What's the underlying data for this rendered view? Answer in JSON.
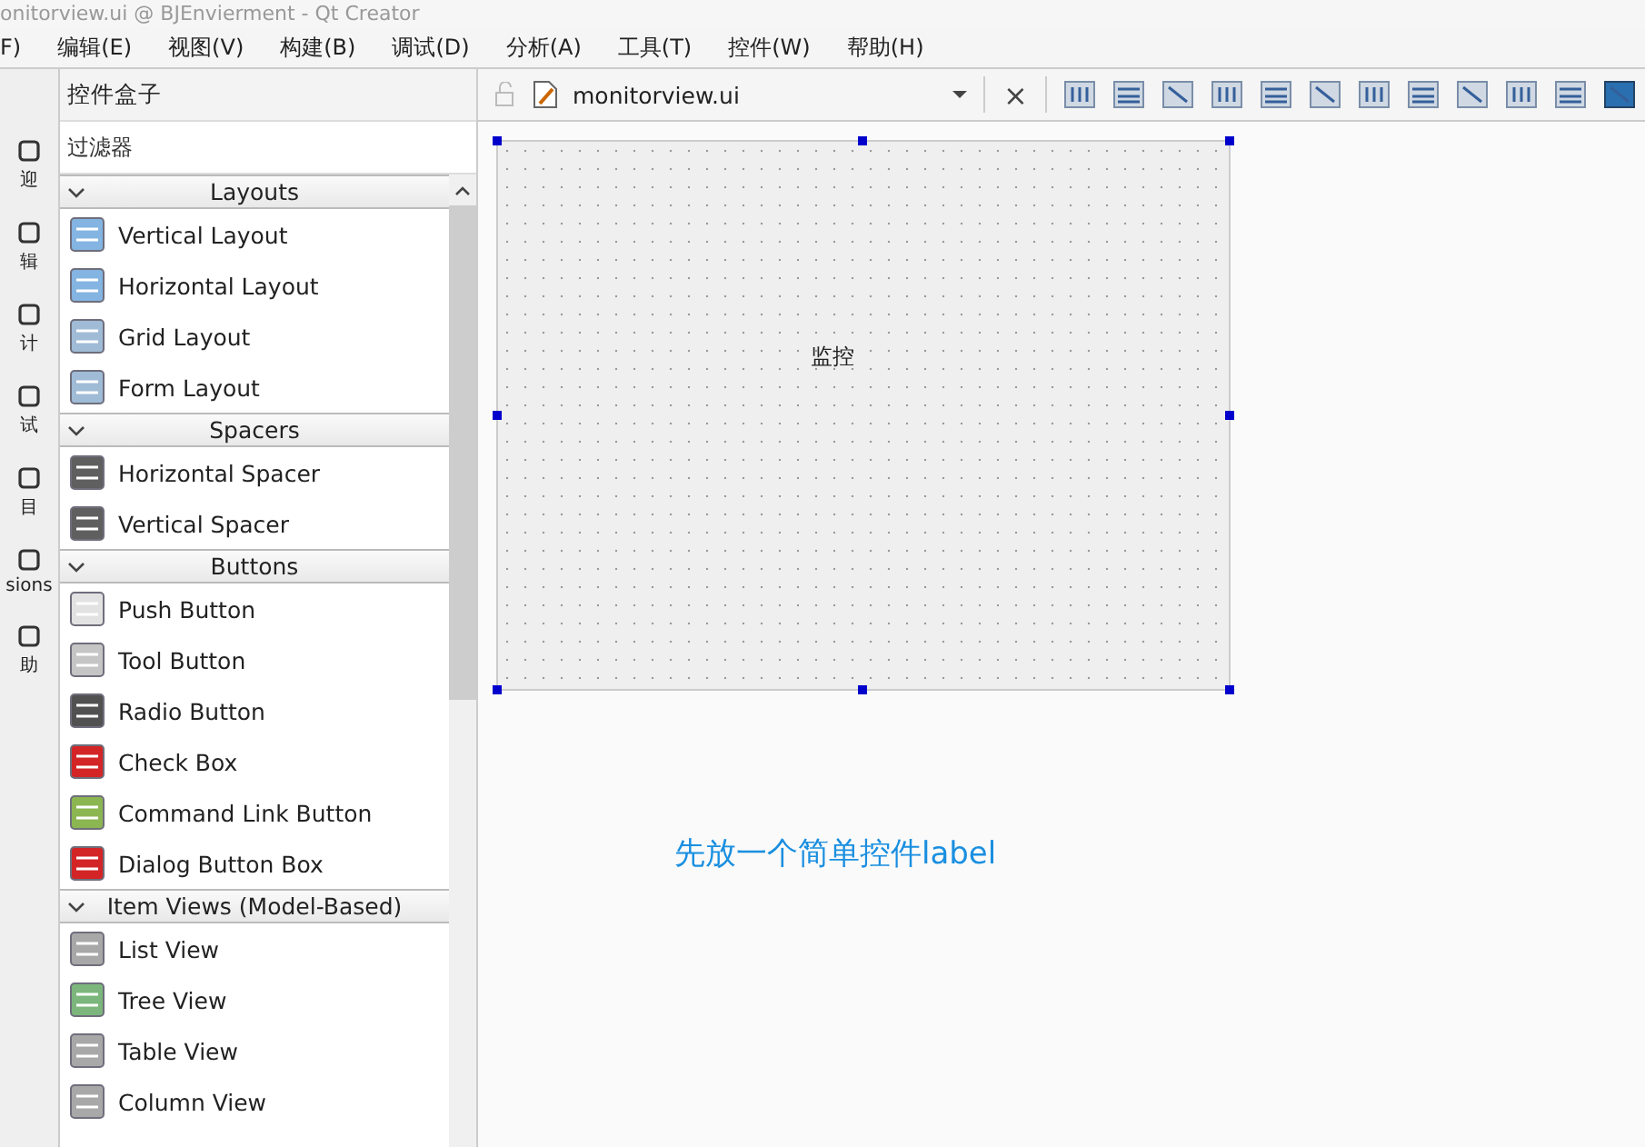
{
  "window": {
    "title": "onitorview.ui @ BJEnvierment - Qt Creator"
  },
  "menu": [
    "F)",
    "编辑(E)",
    "视图(V)",
    "构建(B)",
    "调试(D)",
    "分析(A)",
    "工具(T)",
    "控件(W)",
    "帮助(H)"
  ],
  "mode_bar": [
    {
      "label": "迎"
    },
    {
      "label": "辑"
    },
    {
      "label": "计"
    },
    {
      "label": "试"
    },
    {
      "label": "目"
    },
    {
      "label": "sions"
    },
    {
      "label": "助"
    }
  ],
  "widget_box": {
    "title": "控件盒子",
    "filter": {
      "placeholder": "过滤器"
    },
    "categories": [
      {
        "name": "Layouts",
        "expanded": true,
        "items": [
          "Vertical Layout",
          "Horizontal Layout",
          "Grid Layout",
          "Form Layout"
        ]
      },
      {
        "name": "Spacers",
        "expanded": true,
        "items": [
          "Horizontal Spacer",
          "Vertical Spacer"
        ]
      },
      {
        "name": "Buttons",
        "expanded": true,
        "items": [
          "Push Button",
          "Tool Button",
          "Radio Button",
          "Check Box",
          "Command Link Button",
          "Dialog Button Box"
        ]
      },
      {
        "name": "Item Views (Model-Based)",
        "expanded": true,
        "items": [
          "List View",
          "Tree View",
          "Table View",
          "Column View"
        ]
      }
    ]
  },
  "editor": {
    "file": "monitorview.ui",
    "close": "×"
  },
  "form": {
    "label": "监控"
  },
  "annotation": "先放一个简单控件label"
}
